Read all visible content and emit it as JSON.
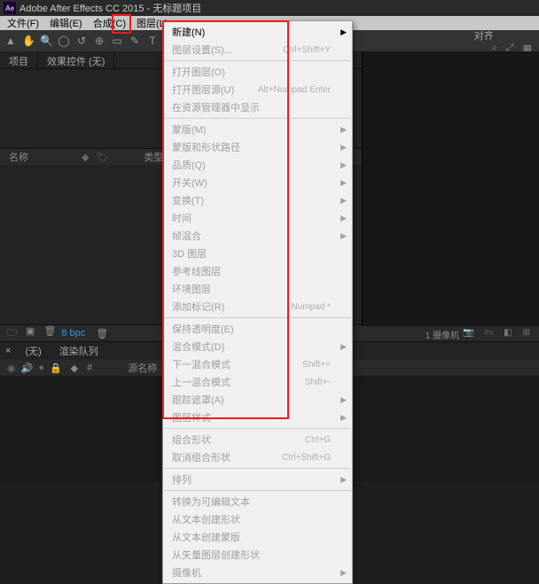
{
  "titlebar": {
    "app": "Adobe After Effects CC 2015",
    "sep": " - ",
    "project": "无标题项目"
  },
  "menubar": {
    "file": "文件(F)",
    "edit": "编辑(E)",
    "composition": "合成(C)",
    "layer": "图层(L)"
  },
  "toolbar": {
    "align_label": "对齐"
  },
  "panel_tabs": {
    "project": "项目",
    "effect_controls": "效果控件 (无)"
  },
  "project": {
    "name_col": "名称",
    "type_col": "类型"
  },
  "comp_bar": {
    "bpc": "8 bpc"
  },
  "timeline": {
    "none_tab": "(无)",
    "render_queue": "渲染队列",
    "source_name": "源名称"
  },
  "right_panel": {
    "cam": "1 摄像机"
  },
  "menu": {
    "new": "新建(N)",
    "layer_settings": "图层设置(S)...",
    "layer_settings_sc": "Ctrl+Shift+Y",
    "open_layer": "打开图层(O)",
    "open_layer_source": "打开图层源(U)",
    "open_layer_source_sc": "Alt+Numpad Enter",
    "reveal_in_manager": "在资源管理器中显示",
    "mask": "蒙版(M)",
    "mask_shape": "蒙版和形状路径",
    "quality": "品质(Q)",
    "switches": "开关(W)",
    "transform": "变换(T)",
    "time": "时间",
    "frame_blend": "帧混合",
    "3d_layer": "3D 图层",
    "guide_layer": "参考线图层",
    "env_layer": "环境图层",
    "add_marker": "添加标记(R)",
    "add_marker_sc": "Numpad *",
    "preserve_trans": "保持透明度(E)",
    "blend_mode": "混合模式(D)",
    "next_blend": "下一混合模式",
    "next_blend_sc": "Shift+=",
    "prev_blend": "上一混合模式",
    "prev_blend_sc": "Shift+-",
    "track_matte": "跟踪遮罩(A)",
    "layer_style": "图层样式",
    "group_shape": "组合形状",
    "group_shape_sc": "Ctrl+G",
    "ungroup_shape": "取消组合形状",
    "ungroup_shape_sc": "Ctrl+Shift+G",
    "arrange": "排列",
    "convert_editable": "转换为可编辑文本",
    "create_shape_from_text": "从文本创建形状",
    "create_mask_from_text": "从文本创建蒙版",
    "create_shape_from_vector": "从矢量图层创建形状",
    "camera": "摄像机"
  }
}
